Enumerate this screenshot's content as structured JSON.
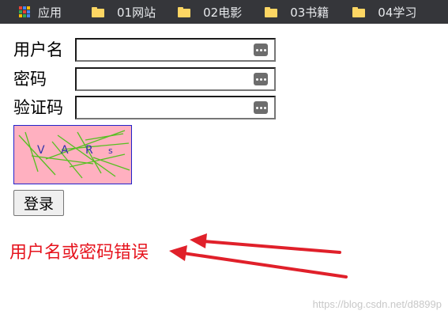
{
  "bookmarks": {
    "items": [
      {
        "label": "应用",
        "icon": "apps-grid-icon"
      },
      {
        "label": "01网站",
        "icon": "folder-icon"
      },
      {
        "label": "02电影",
        "icon": "folder-icon"
      },
      {
        "label": "03书籍",
        "icon": "folder-icon"
      },
      {
        "label": "04学习",
        "icon": "folder-icon"
      }
    ]
  },
  "form": {
    "username_label": "用户名",
    "username_value": "",
    "password_label": "密码",
    "password_value": "",
    "captcha_label": "验证码",
    "captcha_value": "",
    "captcha_text": [
      "V",
      "A",
      "R",
      "s"
    ],
    "login_label": "登录"
  },
  "error": {
    "message": "用户名或密码错误"
  },
  "watermark": "https://blog.csdn.net/d8899p",
  "colors": {
    "error": "#e6141e",
    "arrow": "#e0202a",
    "captcha_bg": "#ffb0c0",
    "bookmarks_bg": "#35363a",
    "folder": "#fdd663"
  }
}
